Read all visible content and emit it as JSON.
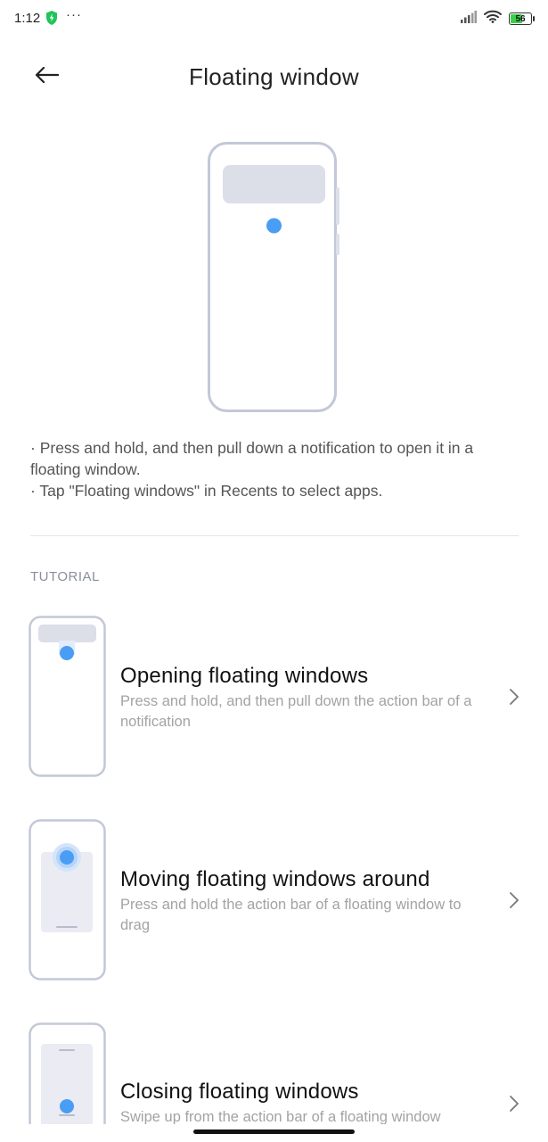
{
  "status_bar": {
    "time": "1:12",
    "shield_icon": "shield-lightning-icon",
    "more_icon": "···",
    "battery_level": "56",
    "colors": {
      "shield": "#21c45a",
      "battery_fill": "#3bd04b"
    }
  },
  "header": {
    "title": "Floating window",
    "back_icon": "arrow-left-icon"
  },
  "description": {
    "lines": [
      "· Press and hold, and then pull down a notification to open it in a floating window.",
      "· Tap \"Floating windows\" in Recents to select apps."
    ]
  },
  "tutorial": {
    "section_label": "TUTORIAL",
    "items": [
      {
        "title": "Opening floating windows",
        "description": "Press and hold, and then pull down the action bar of a notification"
      },
      {
        "title": "Moving floating windows around",
        "description": "Press and hold the action bar of a floating window to drag"
      },
      {
        "title": "Closing floating windows",
        "description": "Swipe up from the action bar of a floating window"
      }
    ]
  },
  "theme": {
    "accent": "#4a9df5",
    "phone_outline": "#c3c8d8",
    "panel": "#dcdee8"
  }
}
